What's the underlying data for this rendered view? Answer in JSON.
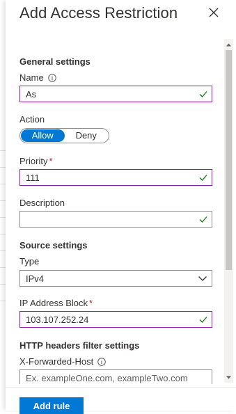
{
  "panel": {
    "title": "Add Access Restriction",
    "add_rule_label": "Add rule"
  },
  "general": {
    "heading": "General settings",
    "name": {
      "label": "Name",
      "value": "As",
      "valid": true
    },
    "action": {
      "label": "Action",
      "options": [
        "Allow",
        "Deny"
      ],
      "selected": "Allow"
    },
    "priority": {
      "label": "Priority",
      "required_mark": "*",
      "value": "111",
      "valid": true
    },
    "description": {
      "label": "Description",
      "value": "",
      "valid": true
    }
  },
  "source": {
    "heading": "Source settings",
    "type": {
      "label": "Type",
      "selected": "IPv4"
    },
    "ip_block": {
      "label": "IP Address Block",
      "required_mark": "*",
      "value": "103.107.252.24",
      "valid": true
    }
  },
  "http_headers": {
    "heading": "HTTP headers filter settings",
    "x_forwarded_host": {
      "label": "X-Forwarded-Host",
      "placeholder": "Ex. exampleOne.com, exampleTwo.com",
      "value": ""
    }
  },
  "colors": {
    "accent": "#0078d4",
    "focus_border": "#8a1a9b",
    "valid_check": "#107c10",
    "required": "#a4262c"
  },
  "icons": [
    "close-icon",
    "info-icon",
    "checkmark-icon",
    "chevron-down-icon"
  ]
}
